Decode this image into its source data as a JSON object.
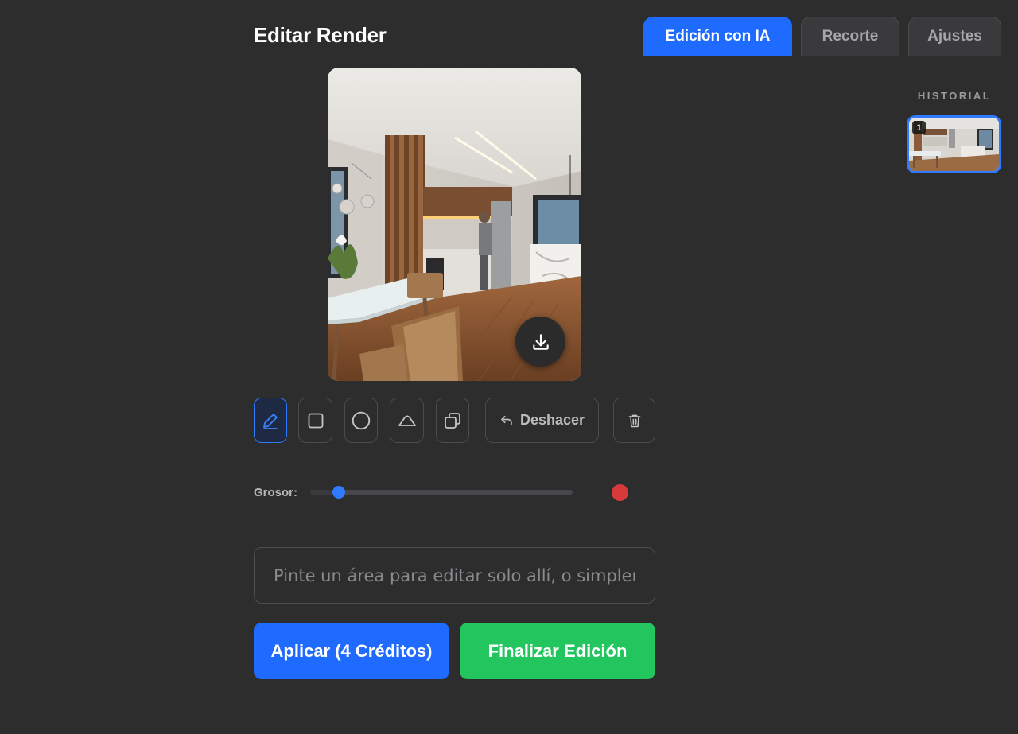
{
  "header": {
    "title": "Editar Render"
  },
  "tabs": [
    {
      "label": "Edición con IA",
      "active": true
    },
    {
      "label": "Recorte",
      "active": false
    },
    {
      "label": "Ajustes",
      "active": false
    }
  ],
  "history": {
    "label": "HISTORIAL",
    "items": [
      {
        "badge": "1",
        "selected": true
      }
    ]
  },
  "preview": {
    "download_icon": "download-icon"
  },
  "toolbar": {
    "tools": [
      {
        "name": "pencil",
        "icon": "pencil-icon",
        "active": true
      },
      {
        "name": "rectangle",
        "icon": "square-icon",
        "active": false
      },
      {
        "name": "circle",
        "icon": "circle-icon",
        "active": false
      },
      {
        "name": "eraser",
        "icon": "eraser-icon",
        "active": false
      },
      {
        "name": "duplicate",
        "icon": "copy-icon",
        "active": false
      }
    ],
    "undo_label": "Deshacer",
    "delete_icon": "trash-icon"
  },
  "brush": {
    "label": "Grosor:",
    "value_fraction": 0.11,
    "color": "#d63a3a"
  },
  "prompt": {
    "placeholder": "Pinte un área para editar solo allí, o simplemente describa el cambio",
    "value": ""
  },
  "actions": {
    "apply_label": "Aplicar (4 Créditos)",
    "finish_label": "Finalizar Edición"
  },
  "colors": {
    "accent": "#1f6bff",
    "success": "#22c55e",
    "background": "#2d2d2e"
  }
}
